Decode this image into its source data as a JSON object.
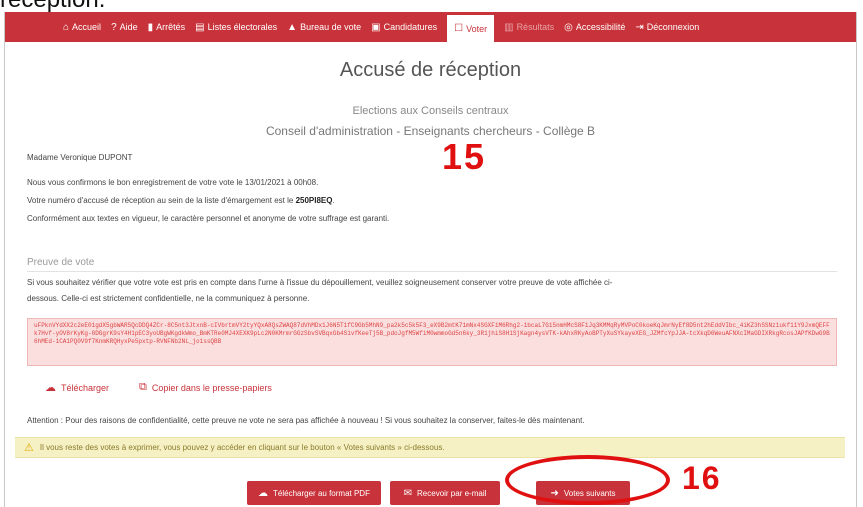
{
  "cropped_caption": "réception.",
  "nav": {
    "items": [
      {
        "label": "Accueil",
        "icon": "home-icon",
        "glyph": "⌂"
      },
      {
        "label": "Aide",
        "icon": "help-icon",
        "glyph": "?"
      },
      {
        "label": "Arrêtés",
        "icon": "document-icon",
        "glyph": "▮"
      },
      {
        "label": "Listes électorales",
        "icon": "list-icon",
        "glyph": "▤"
      },
      {
        "label": "Bureau de vote",
        "icon": "people-icon",
        "glyph": "▲"
      },
      {
        "label": "Candidatures",
        "icon": "id-card-icon",
        "glyph": "▣"
      },
      {
        "label": "Voter",
        "icon": "ballot-icon",
        "glyph": "☐"
      },
      {
        "label": "Résultats",
        "icon": "bar-chart-icon",
        "glyph": "▥"
      },
      {
        "label": "Accessibilité",
        "icon": "accessibility-icon",
        "glyph": "◎"
      },
      {
        "label": "Déconnexion",
        "icon": "logout-icon",
        "glyph": "⇥"
      }
    ]
  },
  "page": {
    "title": "Accusé de réception",
    "subtitle1": "Elections aux Conseils centraux",
    "subtitle2": "Conseil d'administration - Enseignants chercheurs - Collège B"
  },
  "content": {
    "greeting": "Madame Veronique DUPONT",
    "confirm": "Nous vous confirmons le bon enregistrement de votre vote le 13/01/2021 à 00h08.",
    "receipt_prefix": "Votre numéro d'accusé de réception au sein de la liste d'émargement est le",
    "receipt_number": "250PI8EQ",
    "legal": "Conformément aux textes en vigueur, le caractère personnel et anonyme de votre suffrage est garanti.",
    "proof_title": "Preuve de vote",
    "proof_info1": "Si vous souhaitez vérifier que votre vote est pris en compte dans l'urne à l'issue du dépouillement, veuillez soigneusement conserver votre preuve de vote affichée ci-",
    "proof_info2": "dessous. Celle-ci est strictement confidentielle, ne la communiquez à personne.",
    "proof_code": "uFPknVYdXX2c2eE01gdX5gbWAR5QcDDQ4ZCr-8C5nt3JtxnB-cIVbrtmVY2tyYQxA8QsZWAQ87dVhMDx1J6N5T1fC9Gb5MhN9_pa2k5c5k5F3_eX9B2mtK71mNx4SGXF1M6Rhg2-1bcaL7G15nmHMcS8F1Jq3KMMqRyMVPoC0koeKqJmrNyEf8D5nt2hEddVIbc_4iKZ3hSSNz1ukf11Y9JxmQEFFk7Hvf-yOV8rKyKg-0DGgrK9sY4H1pEC3yoUBgWKgdkWmo_BmKTRe0MJ4XEXK9pLc2N0KMrmrGGzSbvSVBqxGb4S1vfKeeTj5B_pdoJgfM5WfiM0wmmoGd5n6ky_3R1jhiS8H1SjKagn4ysVTK-kAhxRKyAoBPTyXuSYkayeXEG_JZMfcYpJJA-tcXkqD6WeuAFNXcIMaGDIXRkgRcosJAPfKDwG9B6hMEd-1CA1PQ0V9f7KnmKRQHyxPe5pxtp-RVNFNb2NL_jo1ssQBB",
    "download_link": "Télécharger",
    "copy_link": "Copier dans le presse-papiers",
    "warning": "Attention : Pour des raisons de confidentialité, cette preuve ne vote ne sera pas affichée à nouveau ! Si vous souhaitez la conserver, faites-le dès maintenant.",
    "notice": "Il vous reste des votes à exprimer, vous pouvez y accéder en cliquant sur le bouton « Votes suivants » ci-dessous."
  },
  "buttons": {
    "pdf": "Télécharger au format PDF",
    "email": "Recevoir par e-mail",
    "next": "Votes suivants"
  },
  "annotations": {
    "step15": "15",
    "step16": "16"
  },
  "colors": {
    "brand": "#c8323a",
    "annotation": "#e01010",
    "notice_bg": "#f6f1c4",
    "proof_bg": "#fbdede"
  }
}
